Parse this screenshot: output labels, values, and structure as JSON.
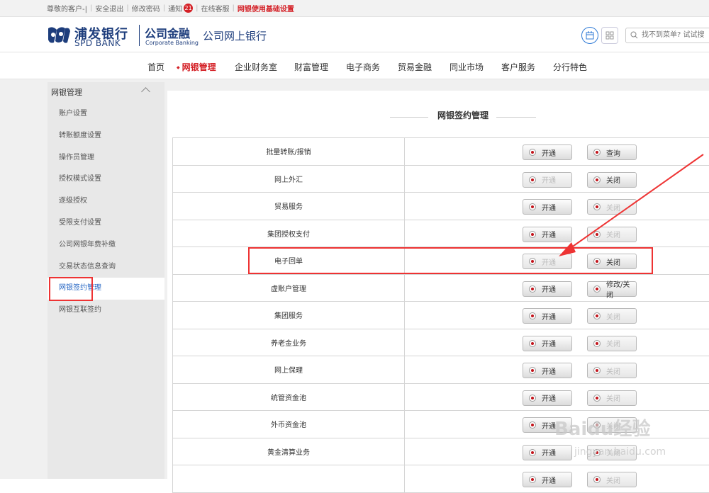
{
  "topbar": {
    "greeting": "尊敬的客户-|",
    "logout": "安全退出",
    "change_password": "修改密码",
    "notice": "通知",
    "notice_count": "21",
    "online_service": "在线客服",
    "basic_settings": "网银使用基础设置"
  },
  "header": {
    "logo_cn": "浦发银行",
    "logo_en": "SPD BANK",
    "corp_cn": "公司金融",
    "corp_en": "Corporate Banking",
    "site_title": "公司网上银行",
    "search_placeholder": "找不到菜单? 试试搜"
  },
  "nav": [
    "首页",
    "网银管理",
    "企业财务室",
    "财富管理",
    "电子商务",
    "贸易金融",
    "同业市场",
    "客户服务",
    "分行特色"
  ],
  "sidebar": {
    "title": "网银管理",
    "items": [
      "账户设置",
      "转账额度设置",
      "操作员管理",
      "授权模式设置",
      "逐级授权",
      "受限支付设置",
      "公司网银年费补缴",
      "交易状态信息查询",
      "网银签约管理",
      "网银互联签约"
    ]
  },
  "content": {
    "title": "网银签约管理",
    "rows": [
      {
        "name": "批量转账/报销",
        "b1": "开通",
        "b2": "查询",
        "b1_disabled": false,
        "b2_disabled": false
      },
      {
        "name": "网上外汇",
        "b1": "开通",
        "b2": "关闭",
        "b1_disabled": true,
        "b2_disabled": false
      },
      {
        "name": "贸易服务",
        "b1": "开通",
        "b2": "关闭",
        "b1_disabled": false,
        "b2_disabled": true
      },
      {
        "name": "集团授权支付",
        "b1": "开通",
        "b2": "关闭",
        "b1_disabled": false,
        "b2_disabled": true
      },
      {
        "name": "电子回单",
        "b1": "开通",
        "b2": "关闭",
        "b1_disabled": true,
        "b2_disabled": false
      },
      {
        "name": "虚账户管理",
        "b1": "开通",
        "b2": "修改/关闭",
        "b1_disabled": false,
        "b2_disabled": false
      },
      {
        "name": "集团服务",
        "b1": "开通",
        "b2": "关闭",
        "b1_disabled": false,
        "b2_disabled": true
      },
      {
        "name": "养老金业务",
        "b1": "开通",
        "b2": "关闭",
        "b1_disabled": false,
        "b2_disabled": true
      },
      {
        "name": "网上保理",
        "b1": "开通",
        "b2": "关闭",
        "b1_disabled": false,
        "b2_disabled": true
      },
      {
        "name": "统管资金池",
        "b1": "开通",
        "b2": "关闭",
        "b1_disabled": false,
        "b2_disabled": true
      },
      {
        "name": "外币资金池",
        "b1": "开通",
        "b2": "关闭",
        "b1_disabled": false,
        "b2_disabled": true
      },
      {
        "name": "黄金清算业务",
        "b1": "开通",
        "b2": "关闭",
        "b1_disabled": false,
        "b2_disabled": true
      },
      {
        "name": "",
        "b1": "开通",
        "b2": "关闭",
        "b1_disabled": false,
        "b2_disabled": true
      }
    ]
  },
  "watermark": {
    "brand": "Baidu经验",
    "url": "jingyan.baidu.com"
  },
  "colors": {
    "accent": "#d42026",
    "brand": "#1d3d7c",
    "link": "#2767c4"
  }
}
